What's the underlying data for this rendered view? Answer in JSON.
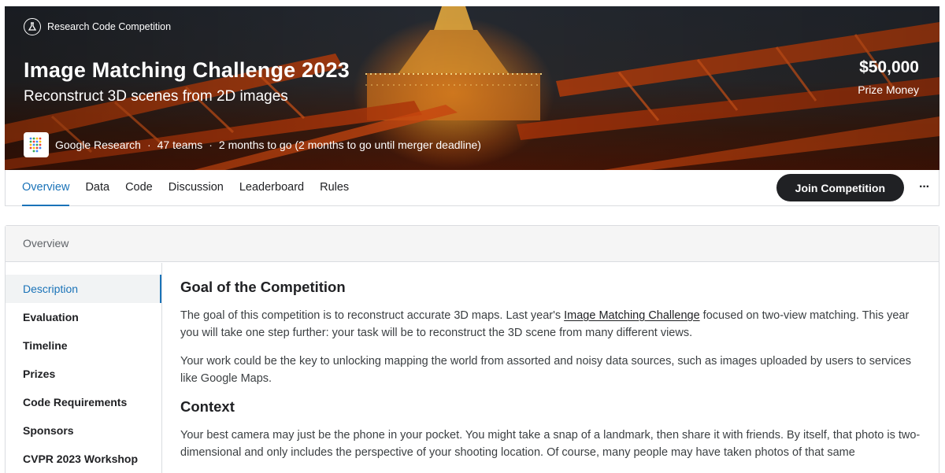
{
  "banner": {
    "badge": "Research Code Competition",
    "title": "Image Matching Challenge 2023",
    "subtitle": "Reconstruct 3D scenes from 2D images",
    "prize_amount": "$50,000",
    "prize_label": "Prize Money",
    "host": "Google Research",
    "teams": "47 teams",
    "deadline": "2 months to go (2 months to go until merger deadline)"
  },
  "nav": {
    "tabs": [
      "Overview",
      "Data",
      "Code",
      "Discussion",
      "Leaderboard",
      "Rules"
    ],
    "active": "Overview",
    "join_label": "Join Competition",
    "more_label": "···"
  },
  "overview": {
    "heading": "Overview",
    "sidebar": [
      "Description",
      "Evaluation",
      "Timeline",
      "Prizes",
      "Code Requirements",
      "Sponsors",
      "CVPR 2023 Workshop"
    ],
    "sidebar_active": "Description",
    "goal_heading": "Goal of the Competition",
    "goal_p1_before": "The goal of this competition is to reconstruct accurate 3D maps. Last year's ",
    "goal_p1_link": "Image Matching Challenge",
    "goal_p1_after": " focused on two-view matching. This year you will take one step further: your task will be to reconstruct the 3D scene from many different views.",
    "goal_p2": "Your work could be the key to unlocking mapping the world from assorted and noisy data sources, such as images uploaded by users to services like Google Maps.",
    "context_heading": "Context",
    "context_p1": "Your best camera may just be the phone in your pocket. You might take a snap of a landmark, then share it with friends. By itself, that photo is two-dimensional and only includes the perspective of your shooting location. Of course, many people may have taken photos of that same"
  },
  "colors": {
    "accent": "#1a73b8",
    "dark_button": "#202124"
  }
}
